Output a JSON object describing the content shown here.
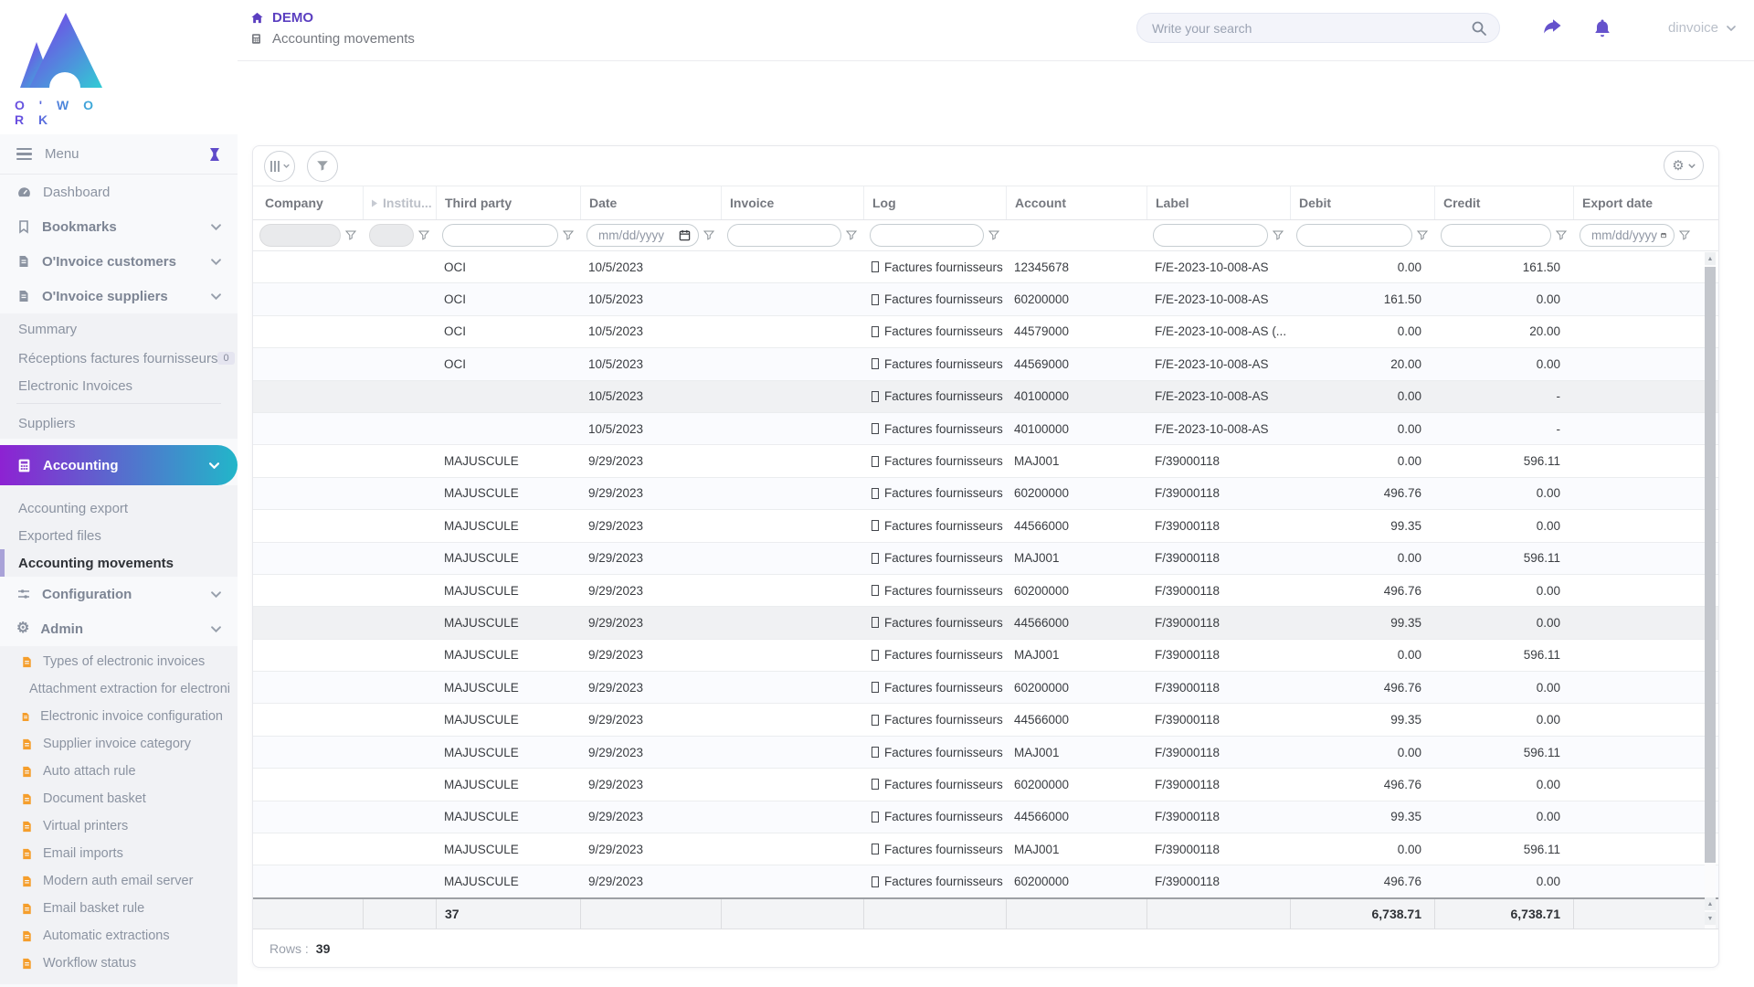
{
  "brand": {
    "wordmark": "O ' W O R K"
  },
  "header": {
    "app_title": "DEMO",
    "breadcrumb": "Accounting movements",
    "search_placeholder": "Write your search",
    "username": "dinvoice"
  },
  "colors": {
    "accent_purple": "#6552cc",
    "gradient_start": "#8d22d2",
    "gradient_end": "#22b6c9",
    "icon_orange": "#f59e2c"
  },
  "sidebar": {
    "menu_label": "Menu",
    "items": [
      {
        "label": "Dashboard"
      },
      {
        "label": "Bookmarks"
      },
      {
        "label": "O'Invoice customers"
      },
      {
        "label": "O'Invoice suppliers"
      }
    ],
    "suppliers_submenu": [
      {
        "label": "Summary"
      },
      {
        "label": "Réceptions factures fournisseurs",
        "badge": "0"
      },
      {
        "label": "Electronic Invoices"
      },
      {
        "label": "Suppliers"
      }
    ],
    "accounting_label": "Accounting",
    "accounting_submenu": [
      {
        "label": "Accounting export"
      },
      {
        "label": "Exported files"
      },
      {
        "label": "Accounting movements"
      }
    ],
    "configuration_label": "Configuration",
    "admin_label": "Admin",
    "admin_submenu": [
      {
        "label": "Types of electronic invoices"
      },
      {
        "label": "Attachment extraction for electroni"
      },
      {
        "label": "Electronic invoice configuration"
      },
      {
        "label": "Supplier invoice category"
      },
      {
        "label": "Auto attach rule"
      },
      {
        "label": "Document basket"
      },
      {
        "label": "Virtual printers"
      },
      {
        "label": "Email imports"
      },
      {
        "label": "Modern auth email server"
      },
      {
        "label": "Email basket rule"
      },
      {
        "label": "Automatic extractions"
      },
      {
        "label": "Workflow status"
      }
    ]
  },
  "table": {
    "columns": [
      "Company",
      "Institu...",
      "Third party",
      "Date",
      "Invoice",
      "Log",
      "Account",
      "Label",
      "Debit",
      "Credit",
      "Export date"
    ],
    "date_placeholder": "mm/dd/yyyy",
    "rows": [
      {
        "company": "",
        "institution": "",
        "third_party": "OCI",
        "date": "10/5/2023",
        "invoice": "",
        "log": "Factures fournisseurs",
        "account": "12345678",
        "label": "F/E-2023-10-008-AS",
        "debit": "0.00",
        "credit": "161.50",
        "export_date": "",
        "shaded": false
      },
      {
        "company": "",
        "institution": "",
        "third_party": "OCI",
        "date": "10/5/2023",
        "invoice": "",
        "log": "Factures fournisseurs",
        "account": "60200000",
        "label": "F/E-2023-10-008-AS",
        "debit": "161.50",
        "credit": "0.00",
        "export_date": "",
        "shaded": false
      },
      {
        "company": "",
        "institution": "",
        "third_party": "OCI",
        "date": "10/5/2023",
        "invoice": "",
        "log": "Factures fournisseurs",
        "account": "44579000",
        "label": "F/E-2023-10-008-AS (...",
        "debit": "0.00",
        "credit": "20.00",
        "export_date": "",
        "shaded": false
      },
      {
        "company": "",
        "institution": "",
        "third_party": "OCI",
        "date": "10/5/2023",
        "invoice": "",
        "log": "Factures fournisseurs",
        "account": "44569000",
        "label": "F/E-2023-10-008-AS",
        "debit": "20.00",
        "credit": "0.00",
        "export_date": "",
        "shaded": false
      },
      {
        "company": "",
        "institution": "",
        "third_party": "",
        "date": "10/5/2023",
        "invoice": "",
        "log": "Factures fournisseurs",
        "account": "40100000",
        "label": "F/E-2023-10-008-AS",
        "debit": "0.00",
        "credit": "-",
        "export_date": "",
        "shaded": true
      },
      {
        "company": "",
        "institution": "",
        "third_party": "",
        "date": "10/5/2023",
        "invoice": "",
        "log": "Factures fournisseurs",
        "account": "40100000",
        "label": "F/E-2023-10-008-AS",
        "debit": "0.00",
        "credit": "-",
        "export_date": "",
        "shaded": false
      },
      {
        "company": "",
        "institution": "",
        "third_party": "MAJUSCULE",
        "date": "9/29/2023",
        "invoice": "",
        "log": "Factures fournisseurs",
        "account": "MAJ001",
        "label": "F/39000118",
        "debit": "0.00",
        "credit": "596.11",
        "export_date": "",
        "shaded": false
      },
      {
        "company": "",
        "institution": "",
        "third_party": "MAJUSCULE",
        "date": "9/29/2023",
        "invoice": "",
        "log": "Factures fournisseurs",
        "account": "60200000",
        "label": "F/39000118",
        "debit": "496.76",
        "credit": "0.00",
        "export_date": "",
        "shaded": false
      },
      {
        "company": "",
        "institution": "",
        "third_party": "MAJUSCULE",
        "date": "9/29/2023",
        "invoice": "",
        "log": "Factures fournisseurs",
        "account": "44566000",
        "label": "F/39000118",
        "debit": "99.35",
        "credit": "0.00",
        "export_date": "",
        "shaded": false
      },
      {
        "company": "",
        "institution": "",
        "third_party": "MAJUSCULE",
        "date": "9/29/2023",
        "invoice": "",
        "log": "Factures fournisseurs",
        "account": "MAJ001",
        "label": "F/39000118",
        "debit": "0.00",
        "credit": "596.11",
        "export_date": "",
        "shaded": false
      },
      {
        "company": "",
        "institution": "",
        "third_party": "MAJUSCULE",
        "date": "9/29/2023",
        "invoice": "",
        "log": "Factures fournisseurs",
        "account": "60200000",
        "label": "F/39000118",
        "debit": "496.76",
        "credit": "0.00",
        "export_date": "",
        "shaded": false
      },
      {
        "company": "",
        "institution": "",
        "third_party": "MAJUSCULE",
        "date": "9/29/2023",
        "invoice": "",
        "log": "Factures fournisseurs",
        "account": "44566000",
        "label": "F/39000118",
        "debit": "99.35",
        "credit": "0.00",
        "export_date": "",
        "shaded": true
      },
      {
        "company": "",
        "institution": "",
        "third_party": "MAJUSCULE",
        "date": "9/29/2023",
        "invoice": "",
        "log": "Factures fournisseurs",
        "account": "MAJ001",
        "label": "F/39000118",
        "debit": "0.00",
        "credit": "596.11",
        "export_date": "",
        "shaded": false
      },
      {
        "company": "",
        "institution": "",
        "third_party": "MAJUSCULE",
        "date": "9/29/2023",
        "invoice": "",
        "log": "Factures fournisseurs",
        "account": "60200000",
        "label": "F/39000118",
        "debit": "496.76",
        "credit": "0.00",
        "export_date": "",
        "shaded": false
      },
      {
        "company": "",
        "institution": "",
        "third_party": "MAJUSCULE",
        "date": "9/29/2023",
        "invoice": "",
        "log": "Factures fournisseurs",
        "account": "44566000",
        "label": "F/39000118",
        "debit": "99.35",
        "credit": "0.00",
        "export_date": "",
        "shaded": false
      },
      {
        "company": "",
        "institution": "",
        "third_party": "MAJUSCULE",
        "date": "9/29/2023",
        "invoice": "",
        "log": "Factures fournisseurs",
        "account": "MAJ001",
        "label": "F/39000118",
        "debit": "0.00",
        "credit": "596.11",
        "export_date": "",
        "shaded": false
      },
      {
        "company": "",
        "institution": "",
        "third_party": "MAJUSCULE",
        "date": "9/29/2023",
        "invoice": "",
        "log": "Factures fournisseurs",
        "account": "60200000",
        "label": "F/39000118",
        "debit": "496.76",
        "credit": "0.00",
        "export_date": "",
        "shaded": false
      },
      {
        "company": "",
        "institution": "",
        "third_party": "MAJUSCULE",
        "date": "9/29/2023",
        "invoice": "",
        "log": "Factures fournisseurs",
        "account": "44566000",
        "label": "F/39000118",
        "debit": "99.35",
        "credit": "0.00",
        "export_date": "",
        "shaded": false
      },
      {
        "company": "",
        "institution": "",
        "third_party": "MAJUSCULE",
        "date": "9/29/2023",
        "invoice": "",
        "log": "Factures fournisseurs",
        "account": "MAJ001",
        "label": "F/39000118",
        "debit": "0.00",
        "credit": "596.11",
        "export_date": "",
        "shaded": false
      },
      {
        "company": "",
        "institution": "",
        "third_party": "MAJUSCULE",
        "date": "9/29/2023",
        "invoice": "",
        "log": "Factures fournisseurs",
        "account": "60200000",
        "label": "F/39000118",
        "debit": "496.76",
        "credit": "0.00",
        "export_date": "",
        "shaded": false
      }
    ],
    "summary": {
      "third_party_count": "37",
      "debit_total": "6,738.71",
      "credit_total": "6,738.71"
    },
    "footer": {
      "rows_label": "Rows :",
      "rows_count": "39"
    }
  }
}
